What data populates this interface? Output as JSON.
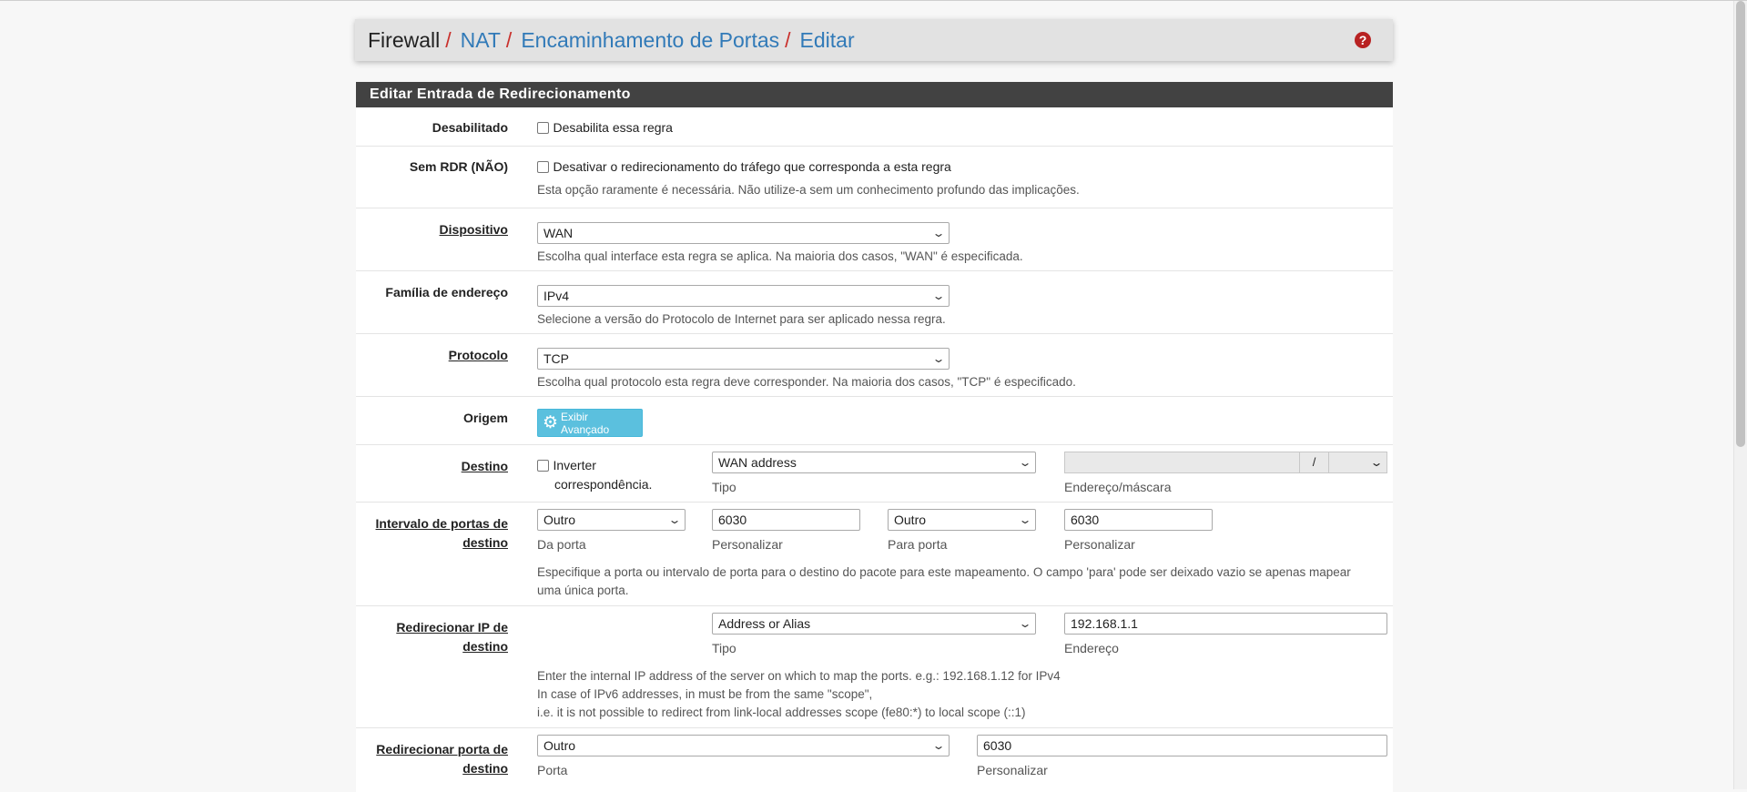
{
  "breadcrumb": {
    "items": [
      {
        "label": "Firewall",
        "link": false
      },
      {
        "label": "NAT",
        "link": true
      },
      {
        "label": "Encaminhamento de Portas",
        "link": true
      },
      {
        "label": "Editar",
        "link": true
      }
    ],
    "separator": "/"
  },
  "help_icon": "question-circle-icon",
  "panel": {
    "title": "Editar Entrada de Redirecionamento"
  },
  "fields": {
    "disabled": {
      "label": "Desabilitado",
      "checkbox_label": "Desabilita essa regra",
      "checked": false
    },
    "nordr": {
      "label": "Sem RDR (NÃO)",
      "checkbox_label": "Desativar o redirecionamento do tráfego que corresponda a esta regra",
      "help": "Esta opção raramente é necessária. Não utilize-a sem um conhecimento profundo das implicações."
    },
    "interface": {
      "label": "Dispositivo",
      "value": "WAN",
      "help": "Escolha qual interface esta regra se aplica. Na maioria dos casos, \"WAN\" é especificada."
    },
    "ipprotocol": {
      "label": "Família de endereço",
      "value": "IPv4",
      "help": "Selecione a versão do Protocolo de Internet para ser aplicado nessa regra."
    },
    "protocol": {
      "label": "Protocolo",
      "value": "TCP",
      "help": "Escolha qual protocolo esta regra deve corresponder. Na maioria dos casos, \"TCP\" é especificado."
    },
    "source": {
      "label": "Origem",
      "button": "Exibir Avançado"
    },
    "destination": {
      "label": "Destino",
      "invert_label_1": "Inverter",
      "invert_label_2": "correspondência.",
      "type_value": "WAN address",
      "type_caption": "Tipo",
      "address_value": "",
      "mask_sep": "/",
      "address_caption": "Endereço/máscara"
    },
    "dst_port_range": {
      "label_1": "Intervalo de portas de",
      "label_2": "destino",
      "from_value": "Outro",
      "from_caption": "Da porta",
      "from_custom": "6030",
      "from_custom_caption": "Personalizar",
      "to_value": "Outro",
      "to_caption": "Para porta",
      "to_custom": "6030",
      "to_custom_caption": "Personalizar",
      "help_1": "Especifique a porta ou intervalo de porta para o destino do pacote para este mapeamento. O campo 'para' pode ser deixado vazio se apenas mapear",
      "help_2": "uma única porta."
    },
    "redirect_ip": {
      "label_1": "Redirecionar IP de",
      "label_2": "destino",
      "type_value": "Address or Alias",
      "type_caption": "Tipo",
      "address_value": "192.168.1.1",
      "address_caption": "Endereço",
      "help_1": "Enter the internal IP address of the server on which to map the ports. e.g.: 192.168.1.12 for IPv4",
      "help_2": "In case of IPv6 addresses, in must be from the same \"scope\",",
      "help_3": "i.e. it is not possible to redirect from link-local addresses scope (fe80:*) to local scope (::1)"
    },
    "redirect_port": {
      "label_1": "Redirecionar porta de",
      "label_2": "destino",
      "port_value": "Outro",
      "port_caption": "Porta",
      "custom_value": "6030",
      "custom_caption": "Personalizar"
    }
  },
  "colors": {
    "link": "#317ab8",
    "separator": "#c9302c",
    "panel_heading": "#424242",
    "button_info": "#5bc0de",
    "help_icon": "#b82222"
  }
}
